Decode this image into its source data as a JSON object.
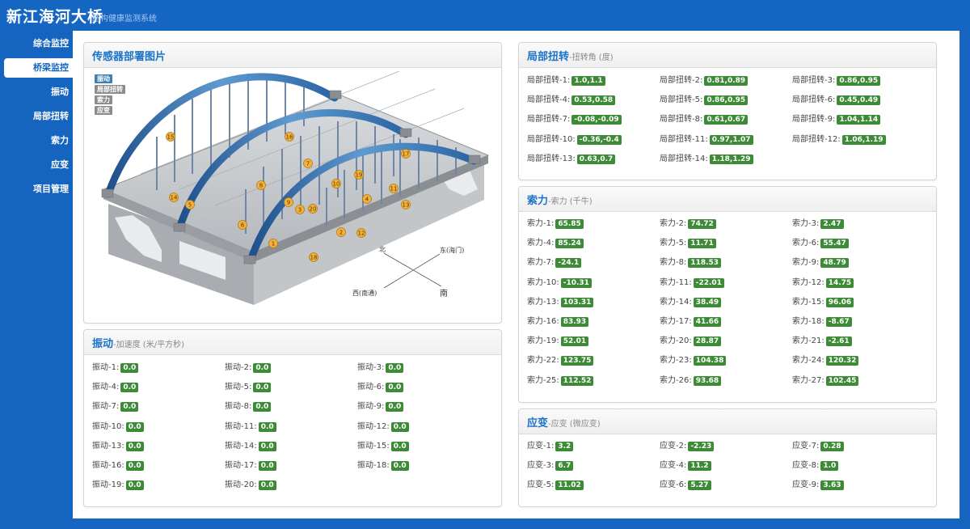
{
  "app": {
    "title": "新江海河大桥",
    "subtitle": "结构健康监测系统"
  },
  "sidebar": {
    "items": [
      {
        "label": "综合监控",
        "active": false
      },
      {
        "label": "桥梁监控",
        "active": true
      },
      {
        "label": "振动",
        "active": false
      },
      {
        "label": "局部扭转",
        "active": false
      },
      {
        "label": "索力",
        "active": false
      },
      {
        "label": "应变",
        "active": false
      },
      {
        "label": "项目管理",
        "active": false
      }
    ]
  },
  "sensor_panel": {
    "title": "传感器部署图片",
    "legend": [
      "振动",
      "局部扭转",
      "索力",
      "应变"
    ],
    "legend_colors": [
      "#3b7fb6",
      "#8c8c8c",
      "#8c8c8c",
      "#8c8c8c"
    ],
    "markers": [
      "1",
      "2",
      "3",
      "4",
      "5",
      "6",
      "7",
      "8",
      "9",
      "10",
      "11",
      "12",
      "13",
      "14",
      "15",
      "16",
      "17",
      "18",
      "19",
      "20"
    ],
    "compass": {
      "north": "北",
      "east": "东(海门)",
      "west": "西(南通)",
      "south": "南"
    }
  },
  "vibration": {
    "title": "振动",
    "subtitle": "-加速度 (米/平方秒)",
    "items": [
      {
        "label": "振动-1:",
        "value": "0.0"
      },
      {
        "label": "振动-2:",
        "value": "0.0"
      },
      {
        "label": "振动-3:",
        "value": "0.0"
      },
      {
        "label": "振动-4:",
        "value": "0.0"
      },
      {
        "label": "振动-5:",
        "value": "0.0"
      },
      {
        "label": "振动-6:",
        "value": "0.0"
      },
      {
        "label": "振动-7:",
        "value": "0.0"
      },
      {
        "label": "振动-8:",
        "value": "0.0"
      },
      {
        "label": "振动-9:",
        "value": "0.0"
      },
      {
        "label": "振动-10:",
        "value": "0.0"
      },
      {
        "label": "振动-11:",
        "value": "0.0"
      },
      {
        "label": "振动-12:",
        "value": "0.0"
      },
      {
        "label": "振动-13:",
        "value": "0.0"
      },
      {
        "label": "振动-14:",
        "value": "0.0"
      },
      {
        "label": "振动-15:",
        "value": "0.0"
      },
      {
        "label": "振动-16:",
        "value": "0.0"
      },
      {
        "label": "振动-17:",
        "value": "0.0"
      },
      {
        "label": "振动-18:",
        "value": "0.0"
      },
      {
        "label": "振动-19:",
        "value": "0.0"
      },
      {
        "label": "振动-20:",
        "value": "0.0"
      }
    ]
  },
  "torsion": {
    "title": "局部扭转",
    "subtitle": "-扭转角 (度)",
    "items": [
      {
        "label": "局部扭转-1:",
        "value": "1.0,1.1"
      },
      {
        "label": "局部扭转-2:",
        "value": "0.81,0.89"
      },
      {
        "label": "局部扭转-3:",
        "value": "0.86,0.95"
      },
      {
        "label": "局部扭转-4:",
        "value": "0.53,0.58"
      },
      {
        "label": "局部扭转-5:",
        "value": "0.86,0.95"
      },
      {
        "label": "局部扭转-6:",
        "value": "0.45,0.49"
      },
      {
        "label": "局部扭转-7:",
        "value": "-0.08,-0.09"
      },
      {
        "label": "局部扭转-8:",
        "value": "0.61,0.67"
      },
      {
        "label": "局部扭转-9:",
        "value": "1.04,1.14"
      },
      {
        "label": "局部扭转-10:",
        "value": "-0.36,-0.4"
      },
      {
        "label": "局部扭转-11:",
        "value": "0.97,1.07"
      },
      {
        "label": "局部扭转-12:",
        "value": "1.06,1.19"
      },
      {
        "label": "局部扭转-13:",
        "value": "0.63,0.7"
      },
      {
        "label": "局部扭转-14:",
        "value": "1.18,1.29"
      }
    ]
  },
  "cable": {
    "title": "索力",
    "subtitle": "-索力 (千牛)",
    "items": [
      {
        "label": "索力-1:",
        "value": "65.85"
      },
      {
        "label": "索力-2:",
        "value": "74.72"
      },
      {
        "label": "索力-3:",
        "value": "2.47"
      },
      {
        "label": "索力-4:",
        "value": "85.24"
      },
      {
        "label": "索力-5:",
        "value": "11.71"
      },
      {
        "label": "索力-6:",
        "value": "55.47"
      },
      {
        "label": "索力-7:",
        "value": "-24.1"
      },
      {
        "label": "索力-8:",
        "value": "118.53"
      },
      {
        "label": "索力-9:",
        "value": "48.79"
      },
      {
        "label": "索力-10:",
        "value": "-10.31"
      },
      {
        "label": "索力-11:",
        "value": "-22.01"
      },
      {
        "label": "索力-12:",
        "value": "14.75"
      },
      {
        "label": "索力-13:",
        "value": "103.31"
      },
      {
        "label": "索力-14:",
        "value": "38.49"
      },
      {
        "label": "索力-15:",
        "value": "96.06"
      },
      {
        "label": "索力-16:",
        "value": "83.93"
      },
      {
        "label": "索力-17:",
        "value": "41.66"
      },
      {
        "label": "索力-18:",
        "value": "-8.67"
      },
      {
        "label": "索力-19:",
        "value": "52.01"
      },
      {
        "label": "索力-20:",
        "value": "28.87"
      },
      {
        "label": "索力-21:",
        "value": "-2.61"
      },
      {
        "label": "索力-22:",
        "value": "123.75"
      },
      {
        "label": "索力-23:",
        "value": "104.38"
      },
      {
        "label": "索力-24:",
        "value": "120.32"
      },
      {
        "label": "索力-25:",
        "value": "112.52"
      },
      {
        "label": "索力-26:",
        "value": "93.68"
      },
      {
        "label": "索力-27:",
        "value": "102.45"
      }
    ]
  },
  "strain": {
    "title": "应变",
    "subtitle": "-应变 (微应变)",
    "items": [
      {
        "label": "应变-1:",
        "value": "3.2"
      },
      {
        "label": "应变-2:",
        "value": "-2.23"
      },
      {
        "label": "应变-7:",
        "value": "0.28"
      },
      {
        "label": "应变-3:",
        "value": "6.7"
      },
      {
        "label": "应变-4:",
        "value": "11.2"
      },
      {
        "label": "应变-8:",
        "value": "1.0"
      },
      {
        "label": "应变-5:",
        "value": "11.02"
      },
      {
        "label": "应变-6:",
        "value": "5.27"
      },
      {
        "label": "应变-9:",
        "value": "3.63"
      }
    ]
  }
}
